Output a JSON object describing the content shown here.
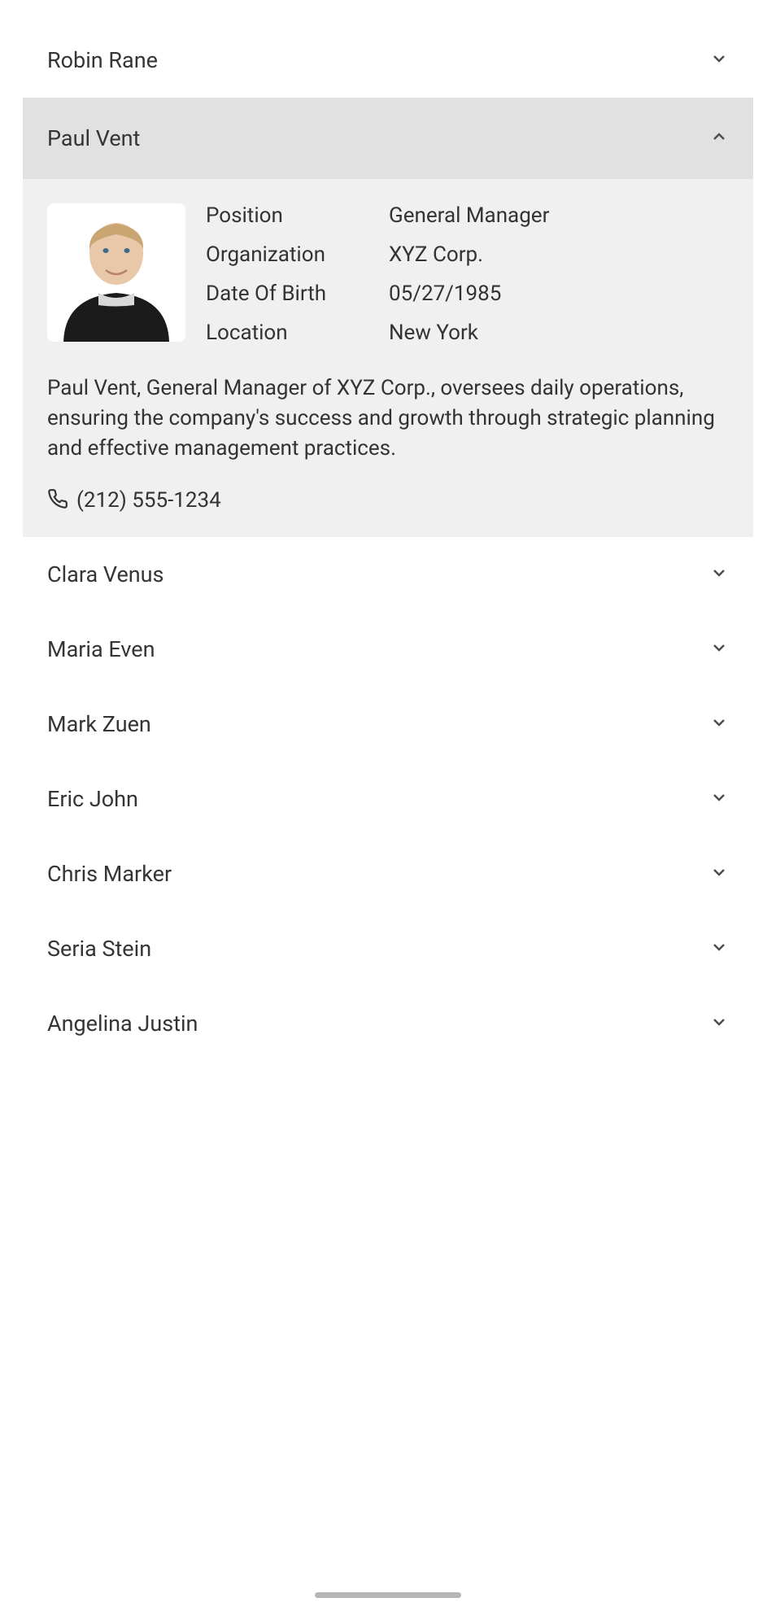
{
  "people": [
    {
      "name": "Robin Rane",
      "expanded": false
    },
    {
      "name": "Paul Vent",
      "expanded": true
    },
    {
      "name": "Clara Venus",
      "expanded": false
    },
    {
      "name": "Maria Even",
      "expanded": false
    },
    {
      "name": "Mark Zuen",
      "expanded": false
    },
    {
      "name": "Eric John",
      "expanded": false
    },
    {
      "name": "Chris Marker",
      "expanded": false
    },
    {
      "name": "Seria Stein",
      "expanded": false
    },
    {
      "name": "Angelina Justin",
      "expanded": false
    }
  ],
  "labels": {
    "position": "Position",
    "organization": "Organization",
    "dob": "Date Of Birth",
    "location": "Location"
  },
  "profile": {
    "position": "General Manager",
    "organization": "XYZ Corp.",
    "dob": "05/27/1985",
    "location": "New York",
    "description": "Paul Vent, General Manager of XYZ Corp., oversees daily operations, ensuring the company's success and growth through strategic planning and effective management practices.",
    "phone": "(212) 555-1234"
  }
}
